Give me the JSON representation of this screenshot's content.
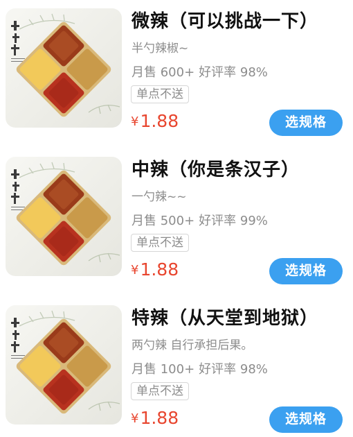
{
  "items": [
    {
      "title": "微辣（可以挑战一下）",
      "desc": "半勺辣椒~",
      "sales": "月售 600+",
      "rating": "好评率 98%",
      "tag": "单点不送",
      "currency": "¥",
      "price": "1.88",
      "button": "选规格",
      "logo_text": "剑之拜"
    },
    {
      "title": "中辣（你是条汉子）",
      "desc": "一勺辣~~",
      "sales": "月售 500+",
      "rating": "好评率 99%",
      "tag": "单点不送",
      "currency": "¥",
      "price": "1.88",
      "button": "选规格",
      "logo_text": "剑之拜"
    },
    {
      "title": "特辣（从天堂到地狱）",
      "desc": "两勺辣 自行承担后果。",
      "sales": "月售 100+",
      "rating": "好评率 98%",
      "tag": "单点不送",
      "currency": "¥",
      "price": "1.88",
      "button": "选规格",
      "logo_text": "剑之拜"
    }
  ],
  "colors": {
    "accent": "#3ba0f0",
    "price": "#e8462f",
    "muted": "#8c8c8c"
  }
}
